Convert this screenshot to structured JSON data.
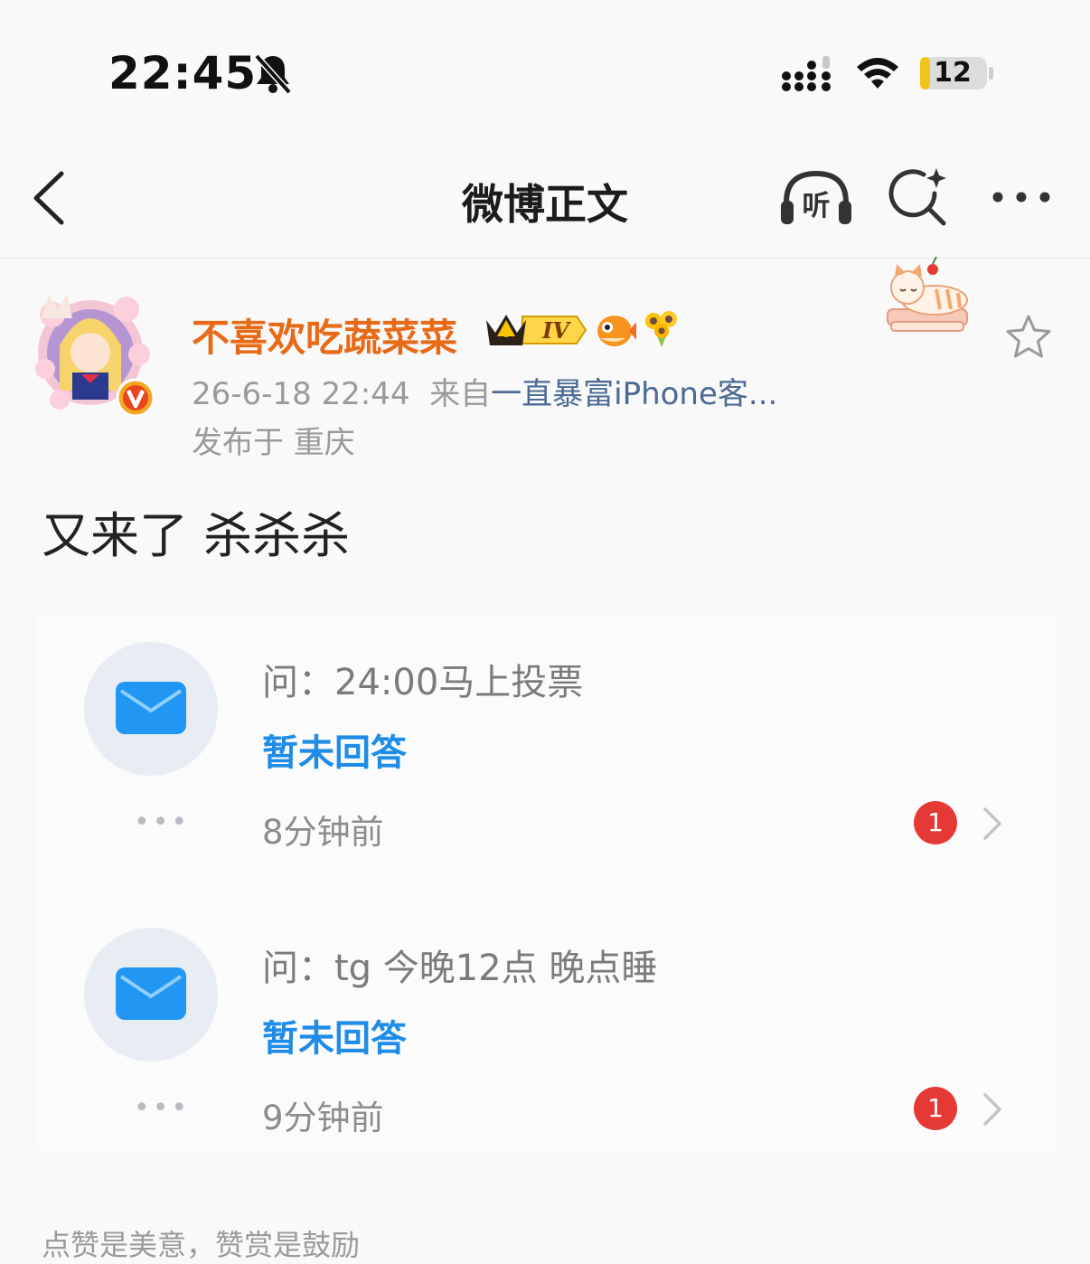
{
  "status_bar": {
    "time": "22:45",
    "battery_level": "12",
    "icons": [
      "bell-slash-icon",
      "signal-icon",
      "wifi-icon",
      "battery-icon"
    ]
  },
  "nav": {
    "title": "微博正文",
    "listen_label": "听",
    "icons": [
      "back-icon",
      "headphones-icon",
      "ai-search-icon",
      "more-icon"
    ]
  },
  "post": {
    "username": "不喜欢吃蔬菜菜",
    "vip_level": "IV",
    "date": "26-6-18 22:44",
    "from_prefix": "来自",
    "source": "一直暴富iPhone客...",
    "location": "发布于 重庆",
    "content": "又来了 杀杀杀",
    "username_color": "#e86a16"
  },
  "qa_items": [
    {
      "question": "问：24:00马上投票",
      "answer": "暂未回答",
      "time": "8分钟前",
      "badge": "1"
    },
    {
      "question": "问：tg 今晚12点 晚点睡",
      "answer": "暂未回答",
      "time": "9分钟前",
      "badge": "1"
    }
  ],
  "footer": {
    "partial_text": "点赞是美意，赞赏是鼓励"
  }
}
